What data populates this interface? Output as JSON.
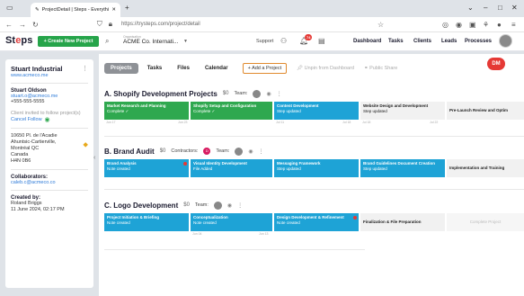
{
  "browser": {
    "tab_title": "ProjectDetail | Steps - Everythin",
    "url": "https://trysteps.com/project/detail"
  },
  "app": {
    "logo_text_a": "St",
    "logo_text_b": "e",
    "logo_text_c": "ps",
    "new_project": "+ Create New Project",
    "org_label": "Organisation",
    "org_name": "ACME Co. Internati...",
    "support": "Support",
    "notif_count": "74",
    "nav": [
      "Dashboard",
      "Tasks",
      "Clients",
      "Leads",
      "Processes"
    ]
  },
  "client": {
    "name": "Stuart Industrial",
    "website": "www.acmeco.me",
    "contact_name": "Stuart Oldson",
    "contact_email": "stuart.o@acmeco.me",
    "contact_phone": "+555-555-5555",
    "invited_note": "Client invited to follow project(s)",
    "cancel_follow": "Cancel Follow",
    "address_line1": "10650 Pl. de l'Acadie",
    "address_line2": "Ahuntsic-Cartierville,",
    "address_line3": "Montréal QC",
    "address_line4": "Canada",
    "address_line5": "H4N 0B6",
    "collaborators_label": "Collaborators:",
    "collaborator_email": "caleb.c@acmeco.co",
    "created_by_label": "Created by:",
    "created_by_name": "Roland Briggs",
    "created_date": "11 June 2024, 02:17 PM"
  },
  "toolbar": {
    "tabs": [
      "Projects",
      "Tasks",
      "Files",
      "Calendar"
    ],
    "add_project": "+ Add a Project",
    "unpin": "Unpin from Dashboard",
    "public_share": "Public Share",
    "dm": "DM"
  },
  "projects": [
    {
      "title": "A. Shopify Development Projects",
      "amount": "$0",
      "team_label": "Team:",
      "cards": [
        {
          "title": "Market Research and Planning",
          "sub": "Complete ✓",
          "color": "green"
        },
        {
          "title": "Shopify Setup and Configuration",
          "sub": "Complete ✓",
          "color": "green"
        },
        {
          "title": "Content Development",
          "sub": "Step updated",
          "color": "blue"
        },
        {
          "title": "Website Design and Development",
          "sub": "Step updated",
          "color": "grey"
        },
        {
          "title": "Pre-Launch Review and Optim",
          "sub": "",
          "color": "grey"
        }
      ],
      "dates": [
        "Jun 17",
        "Jun 23",
        "Jul 11",
        "Jul 18",
        "Jul 18",
        "Jul 22"
      ]
    },
    {
      "title": "B. Brand Audit",
      "amount": "$0",
      "contractors_label": "Contractors:",
      "team_label": "Team:",
      "cards": [
        {
          "title": "Brand Analysis",
          "sub": "Note created",
          "color": "blue"
        },
        {
          "title": "Visual Identity Development",
          "sub": "File Added",
          "color": "blue"
        },
        {
          "title": "Messaging Framework",
          "sub": "Step updated",
          "color": "blue"
        },
        {
          "title": "Brand Guidelines Document Creation",
          "sub": "Step updated",
          "color": "blue"
        },
        {
          "title": "Implementation and Training",
          "sub": "",
          "color": "grey"
        }
      ]
    },
    {
      "title": "C. Logo Development",
      "amount": "$0",
      "team_label": "Team:",
      "cards": [
        {
          "title": "Project Initiation & Briefing",
          "sub": "Note created",
          "color": "blue"
        },
        {
          "title": "Conceptualization",
          "sub": "Note created",
          "color": "blue"
        },
        {
          "title": "Design Development & Refinement",
          "sub": "Note created",
          "color": "blue"
        },
        {
          "title": "Finalization & File Preparation",
          "sub": "",
          "color": "grey"
        },
        {
          "title": "Complete Project",
          "sub": "",
          "color": "light"
        }
      ],
      "dates": [
        "Jun 04",
        "Jun 13"
      ]
    }
  ]
}
